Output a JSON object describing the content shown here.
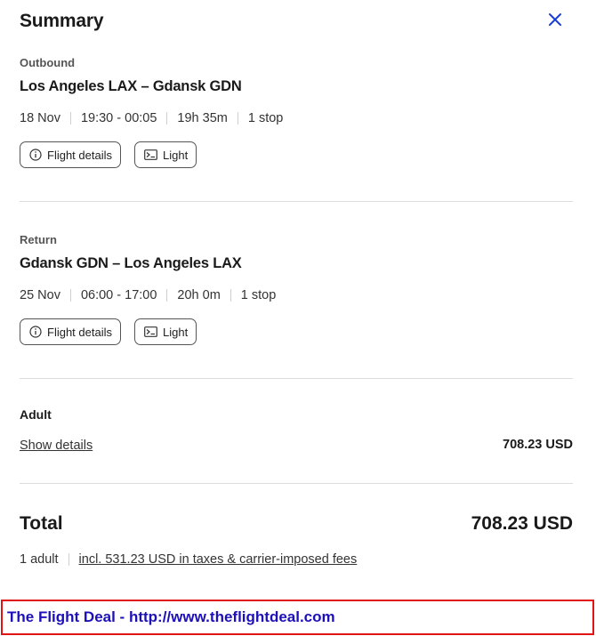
{
  "header": {
    "title": "Summary",
    "close_icon": "close-icon"
  },
  "outbound": {
    "label": "Outbound",
    "route": "Los Angeles LAX – Gdansk GDN",
    "date": "18 Nov",
    "times": "19:30 - 00:05",
    "duration": "19h 35m",
    "stops": "1 stop",
    "flight_details_label": "Flight details",
    "fare_label": "Light"
  },
  "return": {
    "label": "Return",
    "route": "Gdansk GDN – Los Angeles LAX",
    "date": "25 Nov",
    "times": "06:00 - 17:00",
    "duration": "20h 0m",
    "stops": "1 stop",
    "flight_details_label": "Flight details",
    "fare_label": "Light"
  },
  "passenger": {
    "label": "Adult",
    "show_details_label": "Show details",
    "amount": "708.23 USD"
  },
  "total": {
    "label": "Total",
    "amount": "708.23 USD",
    "passengers": "1 adult",
    "taxes_link": "incl. 531.23 USD in taxes & carrier-imposed fees"
  },
  "banner": {
    "text": "The Flight Deal - http://www.theflightdeal.com"
  },
  "colors": {
    "accent": "#1a3fd6",
    "banner_border": "#e01414",
    "banner_text": "#1d10b8"
  }
}
